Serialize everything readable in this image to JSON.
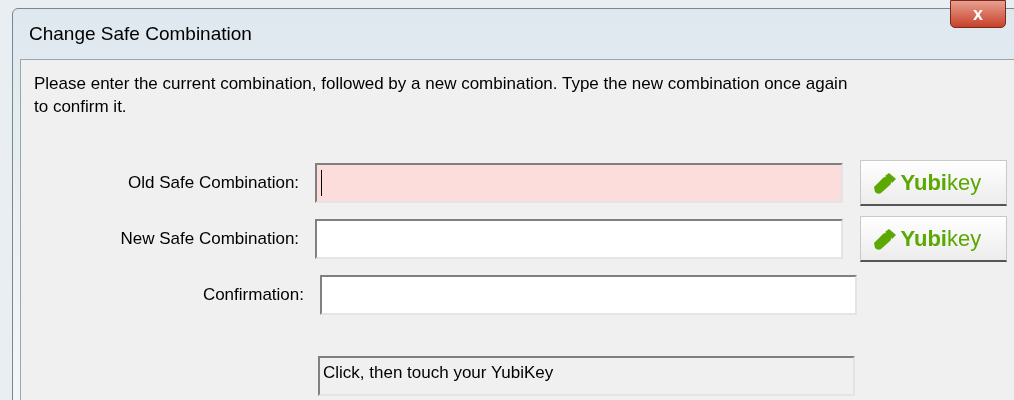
{
  "window": {
    "title": "Change Safe Combination",
    "close": "x"
  },
  "instructions": "Please enter the current combination, followed by a new combination.  Type the new combination once again to confirm it.",
  "fields": [
    {
      "label": "Old Safe Combination:",
      "highlighted": true,
      "focused": true,
      "yubikey_button": "**Yubi**key"
    },
    {
      "label": "New Safe Combination:",
      "highlighted": false,
      "focused": false,
      "yubikey_button": "**Yubi**key"
    },
    {
      "label": "Confirmation:",
      "highlighted": false,
      "focused": false
    }
  ],
  "status": "Click, then touch your YubiKey"
}
